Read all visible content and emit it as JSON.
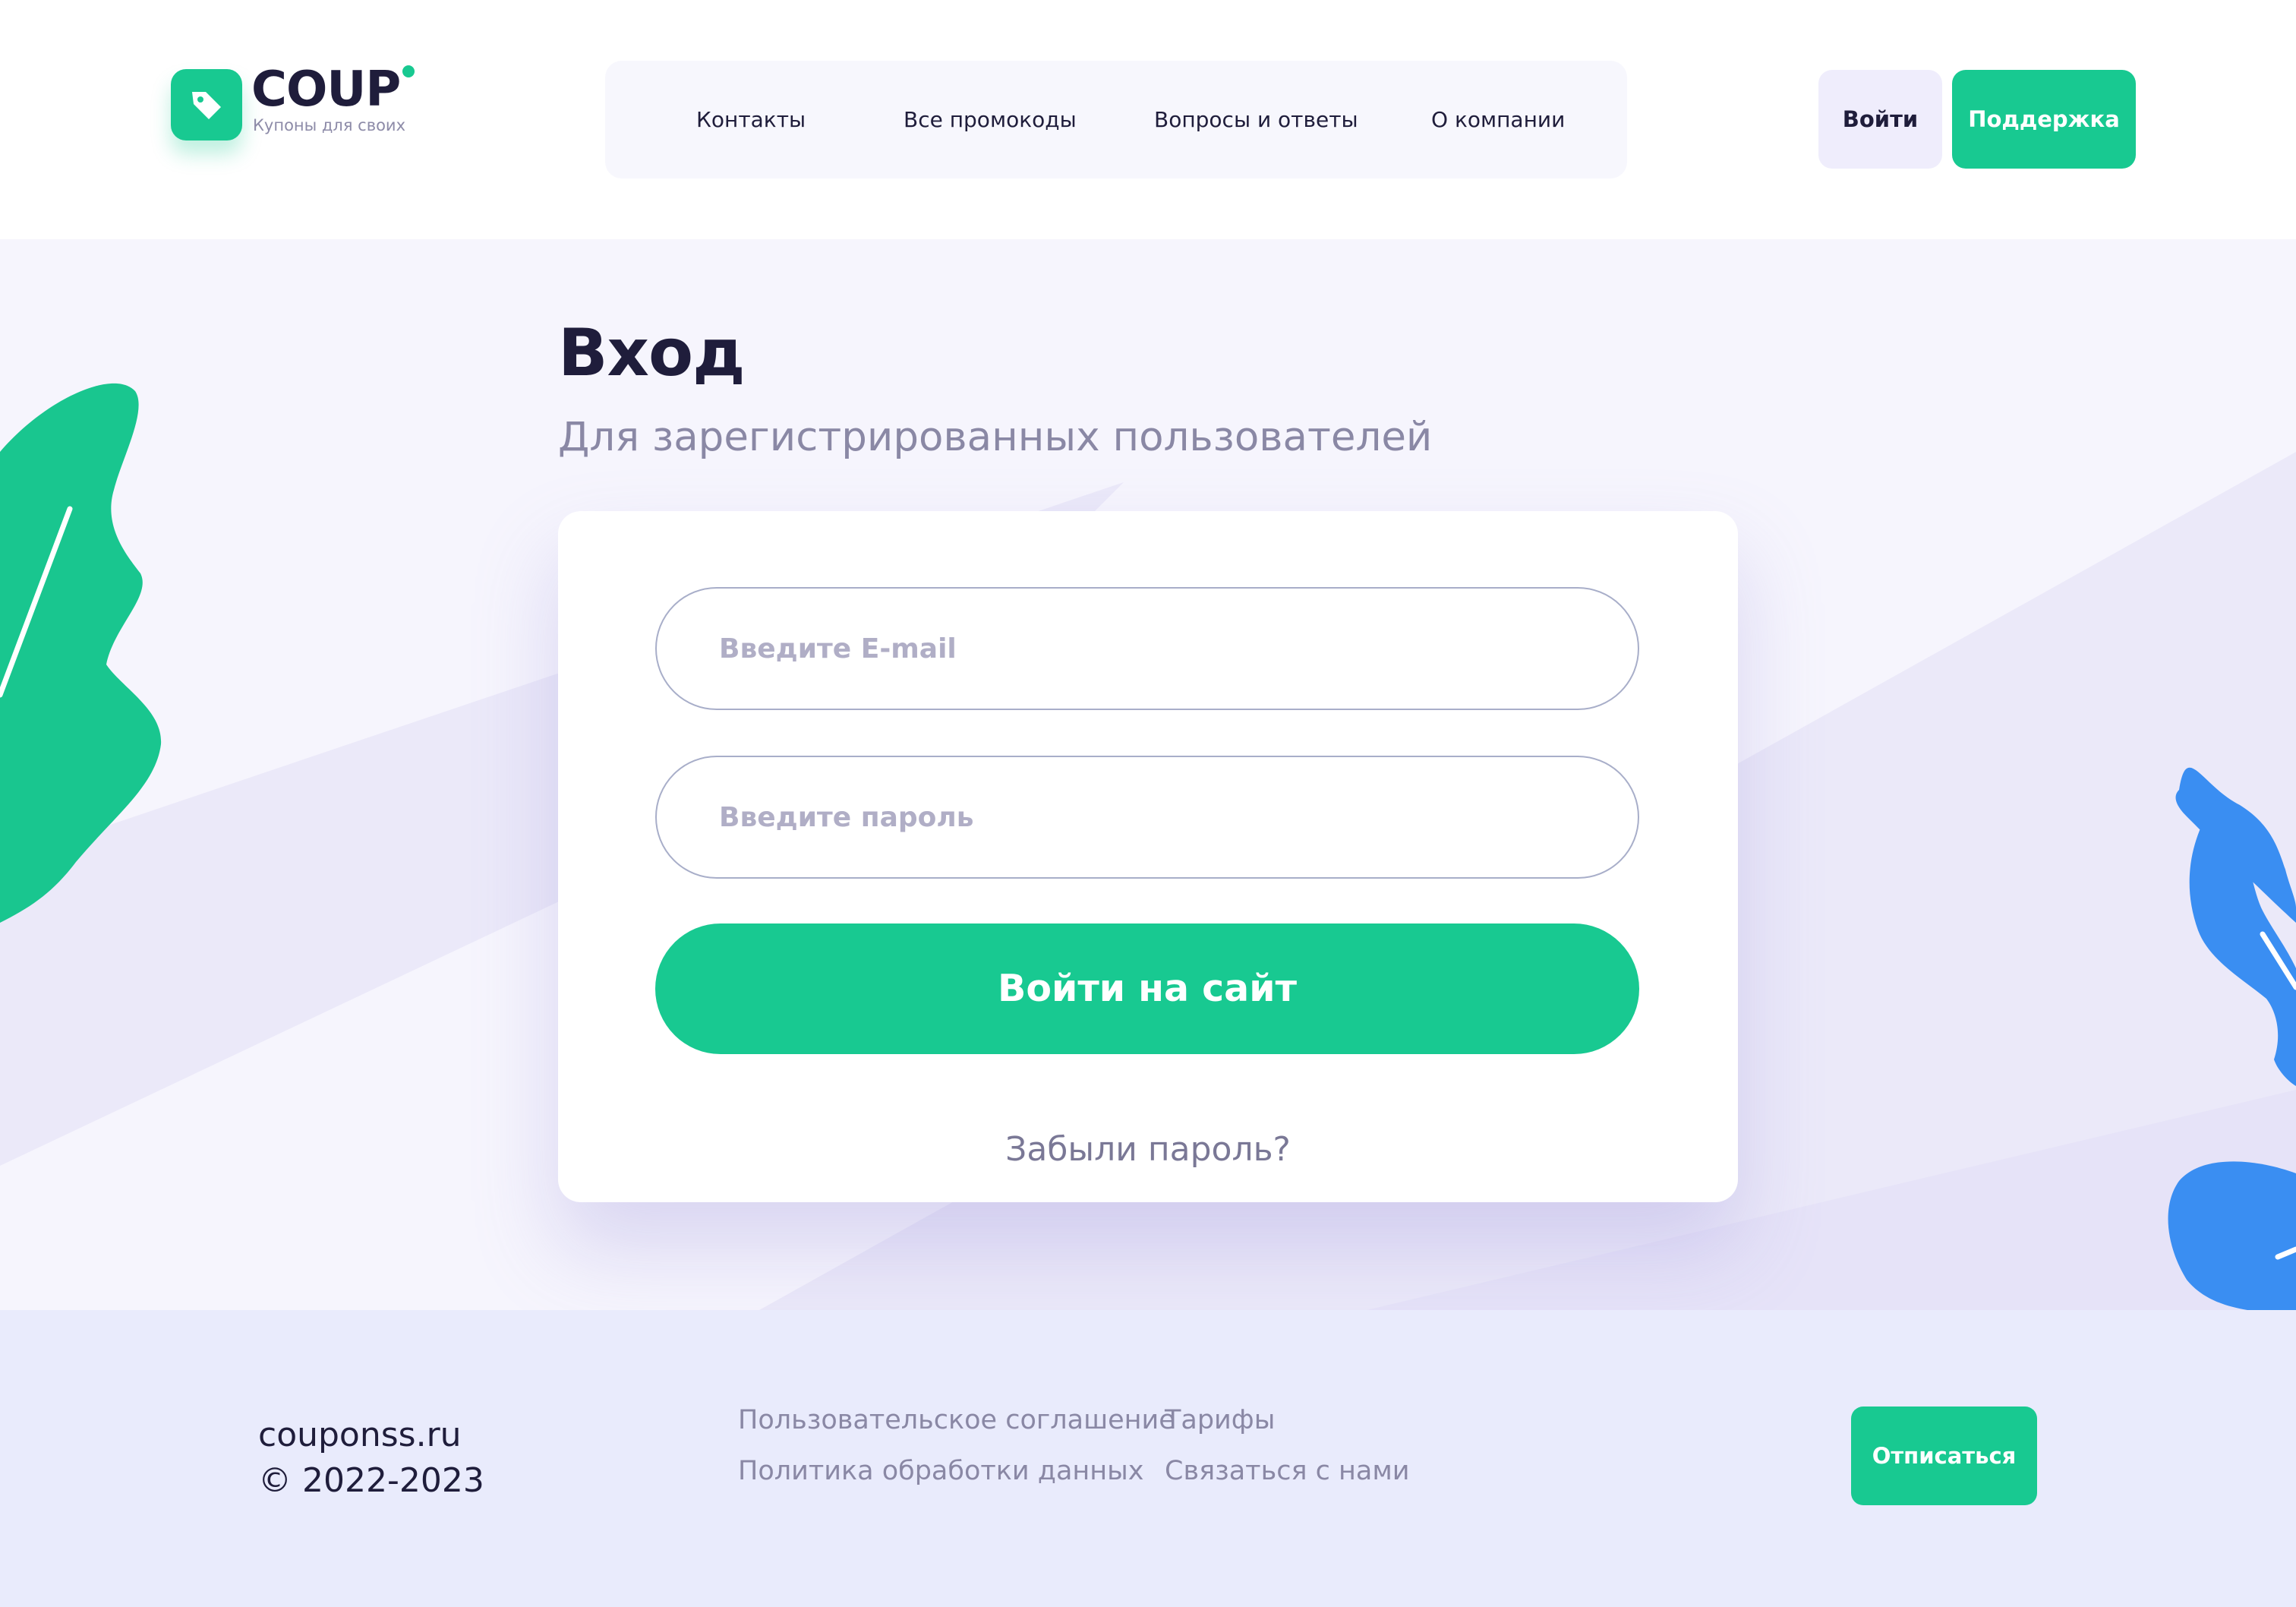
{
  "brand": {
    "name": "COUP",
    "tagline": "Купоны для своих",
    "accent": "#18c991",
    "dark": "#1f1d3b"
  },
  "nav": {
    "items": [
      {
        "label": "Контакты"
      },
      {
        "label": "Все промокоды"
      },
      {
        "label": "Вопросы и ответы"
      },
      {
        "label": "О компании"
      }
    ]
  },
  "header": {
    "login_label": "Войти",
    "support_label": "Поддержка"
  },
  "login": {
    "title": "Вход",
    "subtitle": "Для зарегистрированных пользователей",
    "email_placeholder": "Введите E-mail",
    "password_placeholder": "Введите пароль",
    "submit_label": "Войти на сайт",
    "forgot_label": "Забыли пароль?"
  },
  "footer": {
    "site": "couponss.ru",
    "copyright": "© 2022-2023",
    "links": [
      {
        "label": "Пользовательское соглашение"
      },
      {
        "label": "Тарифы"
      },
      {
        "label": "Политика обработки данных"
      },
      {
        "label": "Связаться с нами"
      }
    ],
    "unsubscribe_label": "Отписаться"
  },
  "icons": {
    "logo": "price-tag-icon",
    "decor_left": "green-leaf-icon",
    "decor_right": "blue-leaf-icon"
  },
  "colors": {
    "green_leaf": "#19c68f",
    "blue_leaf": "#3a8ef2",
    "page_bg": "#f6f5fd",
    "footer_bg": "#e9ebfc"
  }
}
